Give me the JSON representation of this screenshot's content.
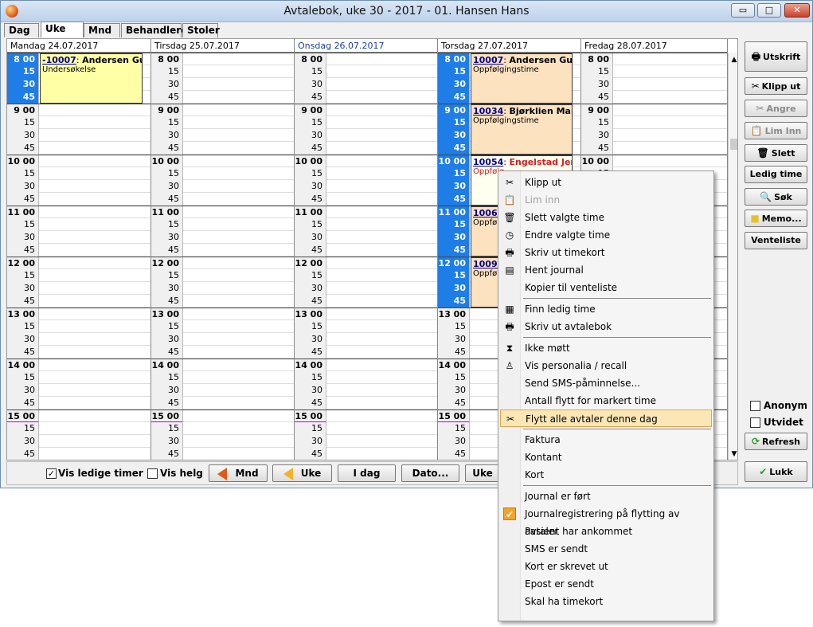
{
  "window": {
    "title": "Avtalebok, uke 30 - 2017  -  01. Hansen Hans",
    "min": "▭",
    "max": "□",
    "close": "✕"
  },
  "tabs": [
    {
      "label": "Dag"
    },
    {
      "label": "Uke"
    },
    {
      "label": "Mnd"
    },
    {
      "label": "Behandlere"
    },
    {
      "label": "Stoler"
    }
  ],
  "days": [
    {
      "header": "Mandag 24.07.2017"
    },
    {
      "header": "Tirsdag 25.07.2017"
    },
    {
      "header": "Onsdag 26.07.2017"
    },
    {
      "header": "Torsdag 27.07.2017"
    },
    {
      "header": "Fredag 28.07.2017"
    }
  ],
  "time_labels": [
    "8 00",
    "15",
    "30",
    "45",
    "9 00",
    "15",
    "30",
    "45",
    "10 00",
    "15",
    "30",
    "45",
    "11 00",
    "15",
    "30",
    "45",
    "12 00",
    "15",
    "30",
    "45",
    "13 00",
    "15",
    "30",
    "45",
    "14 00",
    "15",
    "30",
    "45",
    "15 00",
    "15",
    "30",
    "45"
  ],
  "appointments": {
    "mon1": {
      "id": "-10007",
      "sep": ":",
      "name": "Andersen Gu...",
      "type": "Undersøkelse"
    },
    "thu1": {
      "id": "10007",
      "sep": ":",
      "name": "Andersen Guro",
      "type": "Oppfølgingstime"
    },
    "thu2": {
      "id": "10034",
      "sep": ":",
      "name": "Bjørklien Marie",
      "type": "Oppfølgingstime"
    },
    "thu3": {
      "id": "10054",
      "sep": ":",
      "name": "Engelstad Jen...",
      "type": "Oppfølg"
    },
    "thu4": {
      "id": "10061",
      "sep": ":",
      "type": "Oppfølg"
    },
    "thu5": {
      "id": "10093",
      "sep": ":",
      "type": "Oppfølg"
    }
  },
  "bottombar": {
    "vis_ledige_timer": "Vis ledige timer",
    "vis_helg": "Vis helg",
    "mnd": "Mnd",
    "uke_prev": "Uke",
    "i_dag": "I dag",
    "dato": "Dato...",
    "uke_next": "Uke"
  },
  "sidebar": {
    "utskrift": "Utskrift",
    "klipp_ut": "Klipp ut",
    "angre": "Angre",
    "lim_inn": "Lim Inn",
    "slett": "Slett",
    "ledig_time": "Ledig time",
    "sok": "Søk",
    "memo": "Memo...",
    "venteliste": "Venteliste",
    "anonym": "Anonym",
    "utvidet": "Utvidet",
    "refresh": "Refresh",
    "lukk": "Lukk"
  },
  "context_menu": {
    "items": [
      {
        "label": "Klipp ut",
        "icon": "scissors-icon",
        "disabled": false
      },
      {
        "label": "Lim inn",
        "icon": "paste-icon",
        "disabled": true
      },
      {
        "label": "Slett valgte time",
        "icon": "trash-icon",
        "disabled": false
      },
      {
        "label": "Endre valgte time",
        "icon": "clock-icon",
        "disabled": false
      },
      {
        "label": "Skriv ut timekort",
        "icon": "printer-icon",
        "disabled": false
      },
      {
        "label": "Hent journal",
        "icon": "journal-icon",
        "disabled": false
      },
      {
        "label": "Kopier til venteliste",
        "icon": "",
        "disabled": false
      },
      {
        "label": "Finn ledig time",
        "icon": "calendar-grid-icon",
        "disabled": false
      },
      {
        "label": "Skriv ut avtalebok",
        "icon": "printer-icon",
        "disabled": false
      },
      {
        "label": "Ikke møtt",
        "icon": "hourglass-icon",
        "disabled": false
      },
      {
        "label": "Vis personalia / recall",
        "icon": "person-icon",
        "disabled": false
      },
      {
        "label": "Send SMS-påminnelse...",
        "icon": "",
        "disabled": false
      },
      {
        "label": "Antall flytt for markert time",
        "icon": "",
        "disabled": false
      },
      {
        "label": "Flytt alle avtaler denne dag",
        "icon": "scissors-icon",
        "disabled": false,
        "highlighted": true
      },
      {
        "label": "Faktura",
        "icon": "",
        "disabled": false
      },
      {
        "label": "Kontant",
        "icon": "",
        "disabled": false
      },
      {
        "label": "Kort",
        "icon": "",
        "disabled": false
      },
      {
        "label": "Journal er ført",
        "icon": "",
        "disabled": false
      },
      {
        "label": "Journalregistrering på flytting av avtaler",
        "icon": "checkmark-icon",
        "disabled": false,
        "checked": true
      },
      {
        "label": "Pasient har ankommet",
        "icon": "",
        "disabled": false
      },
      {
        "label": "SMS er sendt",
        "icon": "",
        "disabled": false
      },
      {
        "label": "Kort er skrevet ut",
        "icon": "",
        "disabled": false
      },
      {
        "label": "Epost er sendt",
        "icon": "",
        "disabled": false
      },
      {
        "label": "Skal ha timekort",
        "icon": "",
        "disabled": false
      }
    ]
  },
  "colors": {
    "selected_blue": "#1e7de6",
    "appt_yellow": "#ffffa6",
    "appt_orange": "#fde2c0",
    "menu_highlight": "#fbe7b5"
  }
}
